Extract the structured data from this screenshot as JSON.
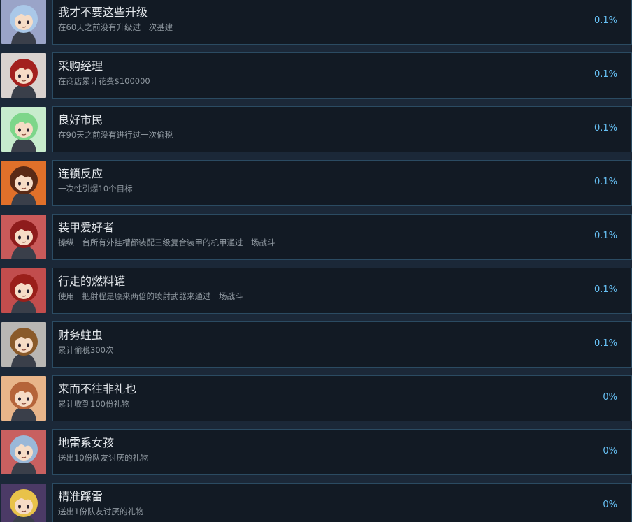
{
  "achievements": [
    {
      "title": "我才不要这些升级",
      "desc": "在60天之前没有升级过一次基建",
      "percent": "0.1%",
      "icon": "blue-hair-anime-girl-icon",
      "bg": "#9aa4c8",
      "hair": "#aac8e8"
    },
    {
      "title": "采购经理",
      "desc": "在商店累计花费$100000",
      "percent": "0.1%",
      "icon": "red-hair-girl-shopping-icon",
      "bg": "#d9d2cf",
      "hair": "#a3201e"
    },
    {
      "title": "良好市民",
      "desc": "在90天之前没有进行过一次偷税",
      "percent": "0.1%",
      "icon": "green-hair-girl-question-icon",
      "bg": "#c7eccd",
      "hair": "#7dd68a"
    },
    {
      "title": "连锁反应",
      "desc": "一次性引爆10个目标",
      "percent": "0.1%",
      "icon": "explosion-figure-icon",
      "bg": "#e0702a",
      "hair": "#5a2a16"
    },
    {
      "title": "装甲爱好者",
      "desc": "操纵一台所有外挂槽都装配三级复合装甲的机甲通过一场战斗",
      "percent": "0.1%",
      "icon": "red-hair-girl-armor-icon",
      "bg": "#c95a5a",
      "hair": "#8e1c1c"
    },
    {
      "title": "行走的燃料罐",
      "desc": "使用一把射程是原来两倍的喷射武器来通过一场战斗",
      "percent": "0.1%",
      "icon": "red-hair-girl-fuel-tank-icon",
      "bg": "#c24d4d",
      "hair": "#9a1f1a"
    },
    {
      "title": "财务蛀虫",
      "desc": "累计偷税300次",
      "percent": "0.1%",
      "icon": "girl-with-money-bags-icon",
      "bg": "#b9b7b4",
      "hair": "#8a5a2a"
    },
    {
      "title": "来而不往非礼也",
      "desc": "累计收到100份礼物",
      "percent": "0%",
      "icon": "girl-receiving-gift-icon",
      "bg": "#e8b58a",
      "hair": "#b5643a"
    },
    {
      "title": "地雷系女孩",
      "desc": "送出10份队友讨厌的礼物",
      "percent": "0%",
      "icon": "blue-hair-girl-landmine-icon",
      "bg": "#c86060",
      "hair": "#9ab8d8"
    },
    {
      "title": "精准踩雷",
      "desc": "送出1份队友讨厌的礼物",
      "percent": "0%",
      "icon": "blonde-girl-closeup-icon",
      "bg": "#4b3a66",
      "hair": "#e8c24a"
    }
  ]
}
